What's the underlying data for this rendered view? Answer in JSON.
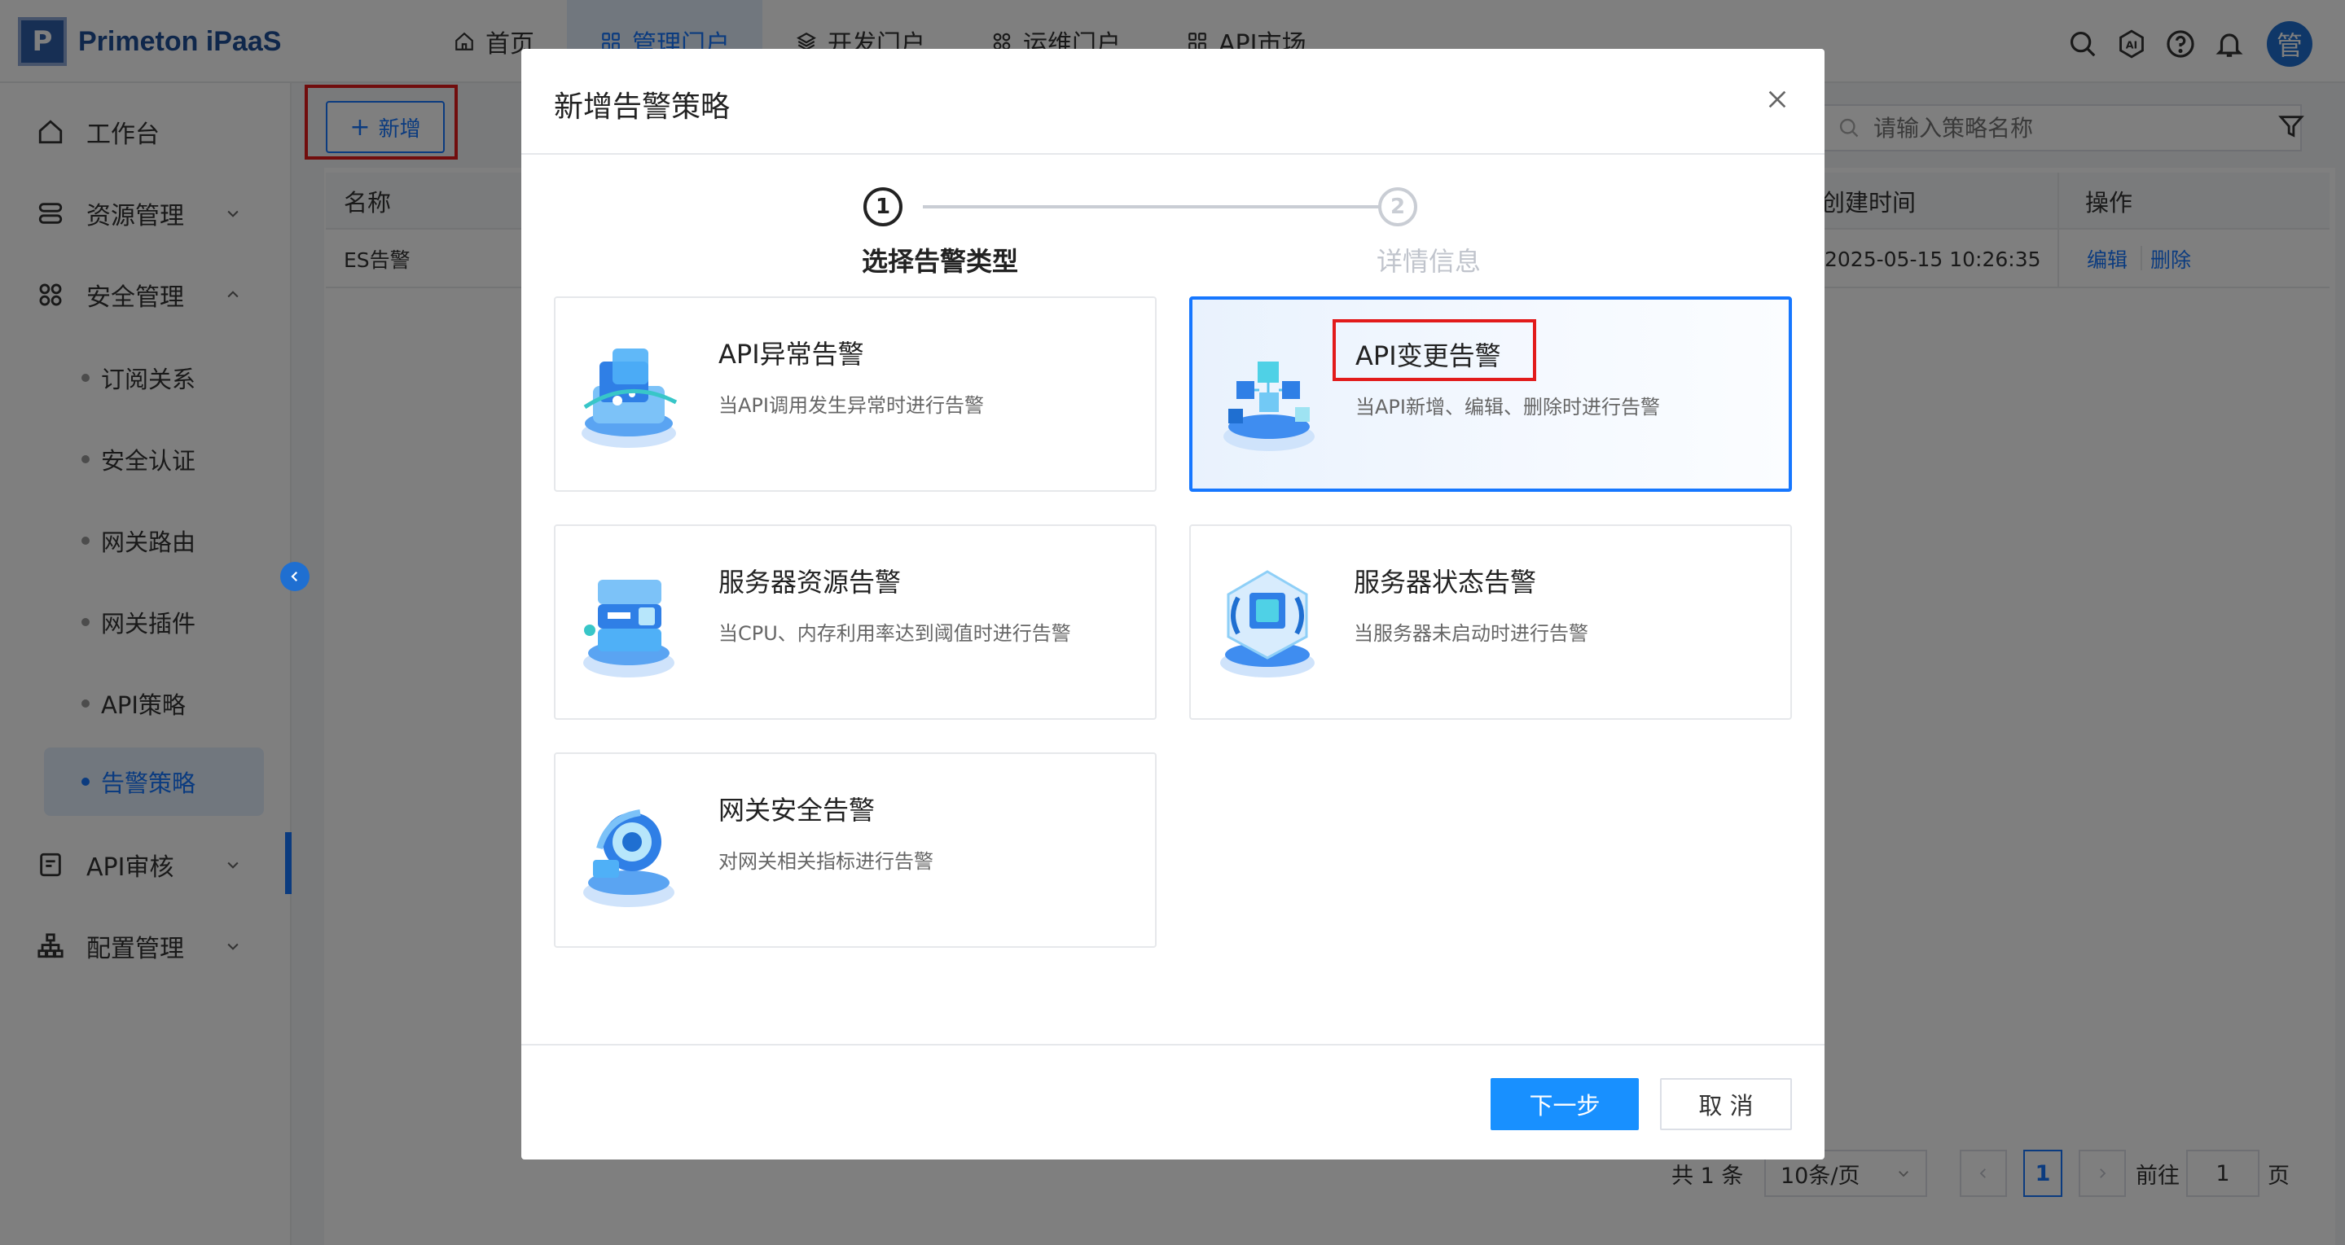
{
  "app": {
    "logo_letter": "P",
    "name": "Primeton iPaaS"
  },
  "nav": [
    {
      "label": "首页",
      "icon": "home-icon"
    },
    {
      "label": "管理门户",
      "icon": "apps-icon"
    },
    {
      "label": "开发门户",
      "icon": "layers-icon"
    },
    {
      "label": "运维门户",
      "icon": "apps-icon"
    },
    {
      "label": "API市场",
      "icon": "apps-icon"
    }
  ],
  "header_icons": {
    "ai_label": "AI",
    "avatar_text": "管"
  },
  "sidebar": {
    "workbench": "工作台",
    "resource": "资源管理",
    "security": "安全管理",
    "security_children": [
      "订阅关系",
      "安全认证",
      "网关路由",
      "网关插件",
      "API策略",
      "告警策略"
    ],
    "api_review": "API审核",
    "config": "配置管理"
  },
  "toolbar": {
    "add_label": "新增",
    "search_placeholder": "请输入策略名称"
  },
  "table": {
    "headers": {
      "name": "名称",
      "created": "创建时间",
      "ops": "操作"
    },
    "rows": [
      {
        "name": "ES告警",
        "created": "2025-05-15 10:26:35",
        "edit": "编辑",
        "delete": "删除"
      }
    ]
  },
  "pagination": {
    "total": "共 1 条",
    "page_size": "10条/页",
    "current": "1",
    "goto_label": "前往",
    "goto_value": "1",
    "page_suffix": "页"
  },
  "modal": {
    "title": "新增告警策略",
    "steps": [
      {
        "num": "1",
        "label": "选择告警类型"
      },
      {
        "num": "2",
        "label": "详情信息"
      }
    ],
    "cards": [
      {
        "title": "API异常告警",
        "desc": "当API调用发生异常时进行告警"
      },
      {
        "title": "API变更告警",
        "desc": "当API新增、编辑、删除时进行告警"
      },
      {
        "title": "服务器资源告警",
        "desc": "当CPU、内存利用率达到阈值时进行告警"
      },
      {
        "title": "服务器状态告警",
        "desc": "当服务器未启动时进行告警"
      },
      {
        "title": "网关安全告警",
        "desc": "对网关相关指标进行告警"
      }
    ],
    "next_label": "下一步",
    "cancel_label": "取 消"
  },
  "colors": {
    "primary": "#1677ff",
    "highlight": "#e21b1b",
    "brand": "#1f4e96"
  }
}
